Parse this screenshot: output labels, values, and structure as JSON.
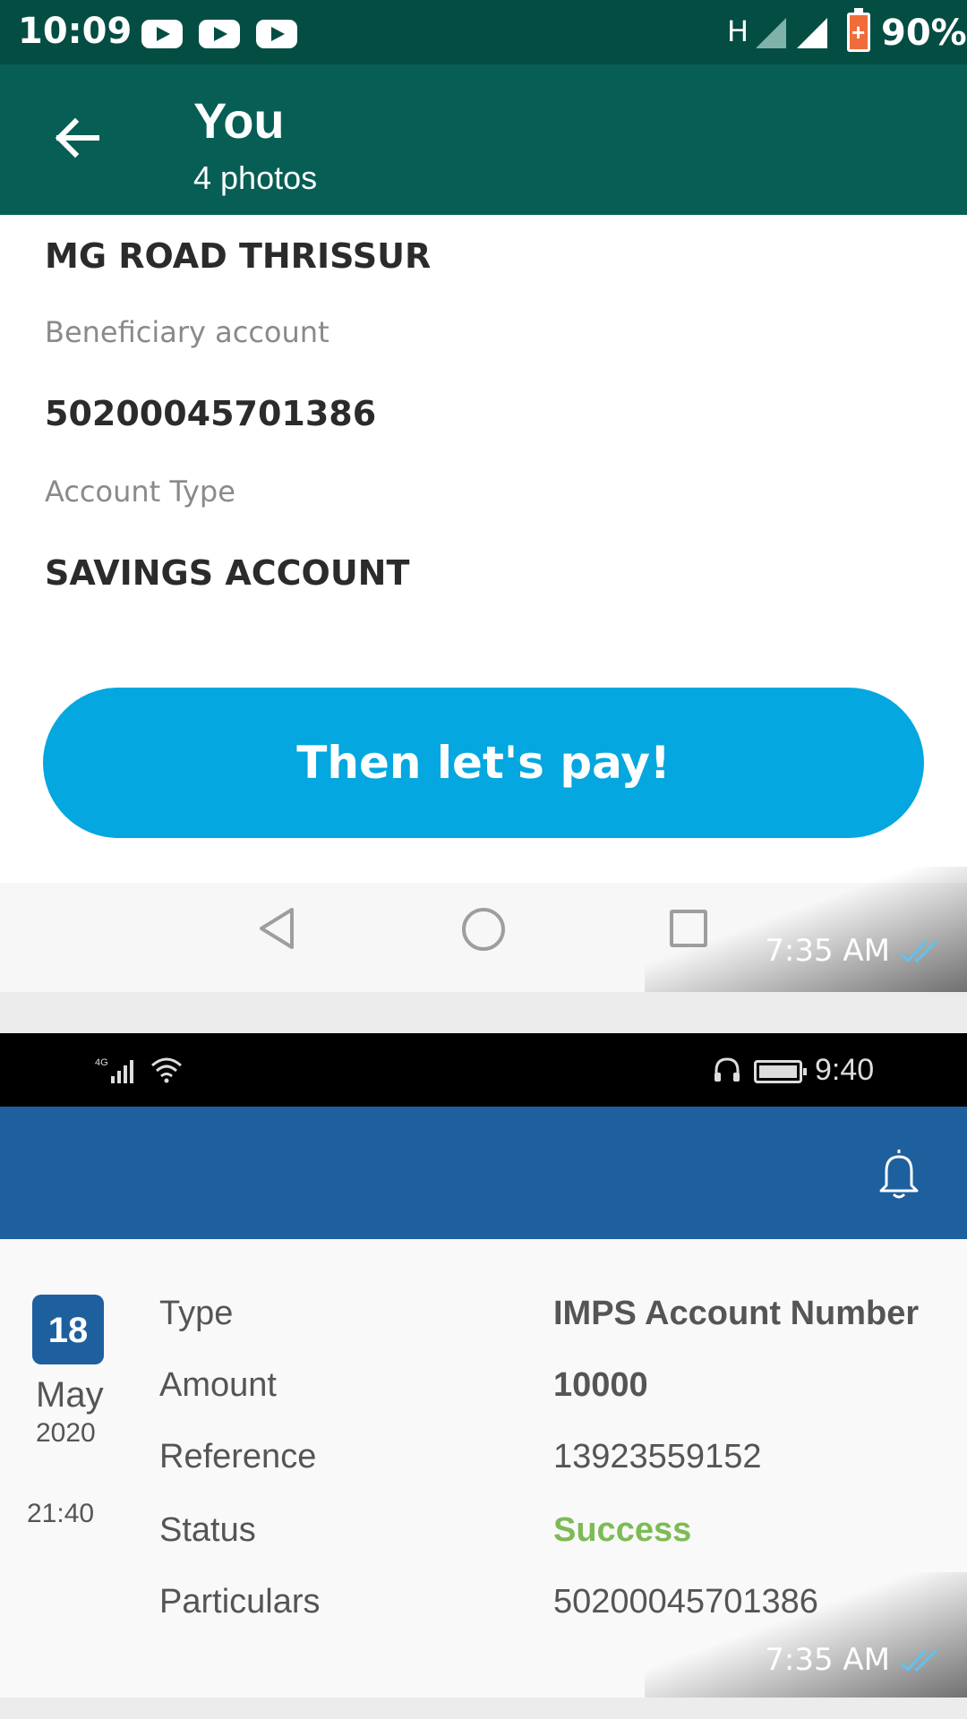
{
  "status_bar": {
    "time": "10:09",
    "network": "H",
    "battery": "90%"
  },
  "header": {
    "title": "You",
    "subtitle": "4 photos"
  },
  "photo1": {
    "branch": "MG ROAD THRISSUR",
    "beneficiary_label": "Beneficiary account",
    "beneficiary_value": "50200045701386",
    "account_type_label": "Account Type",
    "account_type_value": "SAVINGS ACCOUNT",
    "pay_button": "Then let's pay!",
    "timestamp": "7:35 AM"
  },
  "photo2": {
    "status_time": "9:40",
    "date_day": "18",
    "date_month": "May",
    "date_year": "2020",
    "time": "21:40",
    "rows": [
      {
        "label": "Type",
        "value": "IMPS Account Number"
      },
      {
        "label": "Amount",
        "value": "10000"
      },
      {
        "label": "Reference",
        "value": "13923559152"
      },
      {
        "label": "Status",
        "value": "Success"
      },
      {
        "label": "Particulars",
        "value": "50200045701386"
      }
    ],
    "timestamp": "7:35 AM"
  },
  "colors": {
    "whatsapp_green": "#075e54",
    "pay_blue": "#04a7df",
    "bank_blue": "#1e5f9e",
    "success_green": "#7cbb55"
  },
  "icons": [
    "youtube-icon",
    "signal-icon",
    "battery-icon",
    "back-arrow-icon",
    "nav-back-icon",
    "nav-home-icon",
    "nav-recent-icon",
    "read-ticks-icon",
    "wifi-icon",
    "headphones-icon",
    "bell-icon"
  ]
}
